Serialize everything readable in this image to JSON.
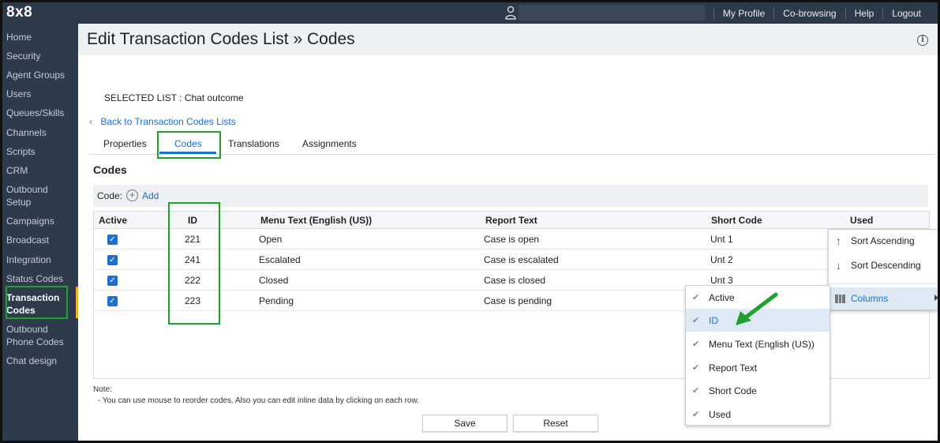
{
  "app": {
    "logo": "8x8"
  },
  "topnav": {
    "links": [
      "My Profile",
      "Co-browsing",
      "Help",
      "Logout"
    ]
  },
  "sidebar": {
    "items": [
      {
        "label": "Home"
      },
      {
        "label": "Security"
      },
      {
        "label": "Agent Groups"
      },
      {
        "label": "Users"
      },
      {
        "label": "Queues/Skills"
      },
      {
        "label": "Channels"
      },
      {
        "label": "Scripts"
      },
      {
        "label": "CRM"
      },
      {
        "label": "Outbound Setup"
      },
      {
        "label": "Campaigns"
      },
      {
        "label": "Broadcast"
      },
      {
        "label": "Integration"
      },
      {
        "label": "Status Codes"
      },
      {
        "label": "Transaction Codes"
      },
      {
        "label": "Outbound Phone Codes"
      },
      {
        "label": "Chat design"
      }
    ],
    "active": "Transaction Codes"
  },
  "page": {
    "title": "Edit Transaction Codes List » Codes",
    "selected_list_label": "SELECTED LIST",
    "selected_list_value": ": Chat outcome",
    "back_link": "Back to Transaction Codes Lists"
  },
  "tabs": [
    "Properties",
    "Codes",
    "Translations",
    "Assignments"
  ],
  "active_tab": "Codes",
  "codes": {
    "heading": "Codes",
    "code_label": "Code:",
    "add_label": "Add"
  },
  "table": {
    "columns": [
      "Active",
      "ID",
      "Menu Text (English (US))",
      "Report Text",
      "Short Code",
      "Used"
    ],
    "rows": [
      {
        "active": true,
        "id": "221",
        "menu_text": "Open",
        "report_text": "Case is open",
        "short_code": "Unt 1"
      },
      {
        "active": true,
        "id": "241",
        "menu_text": "Escalated",
        "report_text": "Case is escalated",
        "short_code": "Unt 2"
      },
      {
        "active": true,
        "id": "222",
        "menu_text": "Closed",
        "report_text": "Case is closed",
        "short_code": "Unt 3"
      },
      {
        "active": true,
        "id": "223",
        "menu_text": "Pending",
        "report_text": "Case is pending",
        "short_code": ""
      }
    ]
  },
  "note": {
    "title": "Note:",
    "text": "- You can use mouse to reorder codes. Also you can edit inline data by clicking on each row."
  },
  "buttons": {
    "save": "Save",
    "reset": "Reset"
  },
  "context_menu": {
    "sort_ascending": "Sort Ascending",
    "sort_descending": "Sort Descending",
    "columns": "Columns"
  },
  "columns_submenu": {
    "items": [
      {
        "label": "Active",
        "checked": true
      },
      {
        "label": "ID",
        "checked": true
      },
      {
        "label": "Menu Text (English (US))",
        "checked": true
      },
      {
        "label": "Report Text",
        "checked": true
      },
      {
        "label": "Short Code",
        "checked": true
      },
      {
        "label": "Used",
        "checked": true
      }
    ],
    "hovered": "ID"
  },
  "colors": {
    "topbar": "#2d3a4a",
    "sidebar": "#2e3b4d",
    "accent": "#1f6fcf",
    "highlight": "#1fa12e",
    "active_marker": "#f0b429"
  }
}
